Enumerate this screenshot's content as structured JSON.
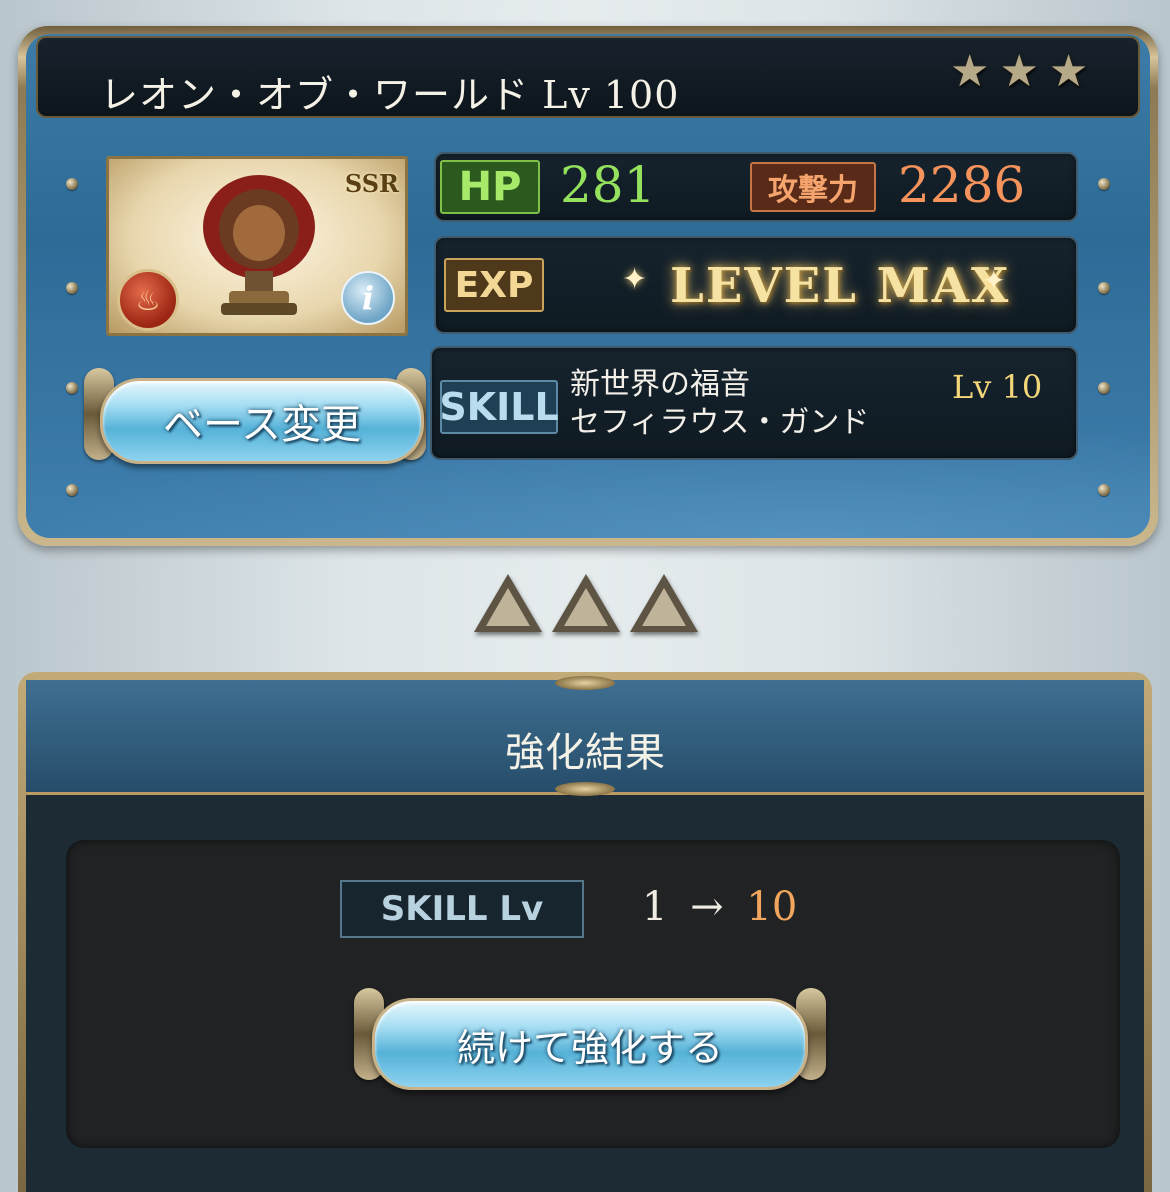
{
  "header": {
    "character_name": "レオン・オブ・ワールド Lv 100",
    "stars": [
      "★",
      "★",
      "★"
    ]
  },
  "portrait": {
    "rarity": "SSR",
    "element_icon": "fire-icon",
    "info_icon": "info-icon",
    "info_label": "i"
  },
  "stats": {
    "hp_label": "HP",
    "hp_value": "281",
    "atk_label": "攻撃力",
    "atk_value": "2286",
    "exp_label": "EXP",
    "exp_status": "LEVEL MAX",
    "skill_label": "SKILL",
    "skill_name_line1": "新世界の福音",
    "skill_name_line2": "セフィラウス・ガンド",
    "skill_level": "Lv 10"
  },
  "buttons": {
    "change_base": "ベース変更",
    "continue_upgrade": "続けて強化する"
  },
  "result": {
    "title": "強化結果",
    "skill_lv_label": "SKILL Lv",
    "from": "1",
    "arrow": "→",
    "to": "10"
  },
  "colors": {
    "hp": "#94e15e",
    "atk": "#f5935c",
    "level_max": "#f6e3a3",
    "skill_lv": "#f4d67a",
    "upgrade_to": "#f2a65d"
  }
}
